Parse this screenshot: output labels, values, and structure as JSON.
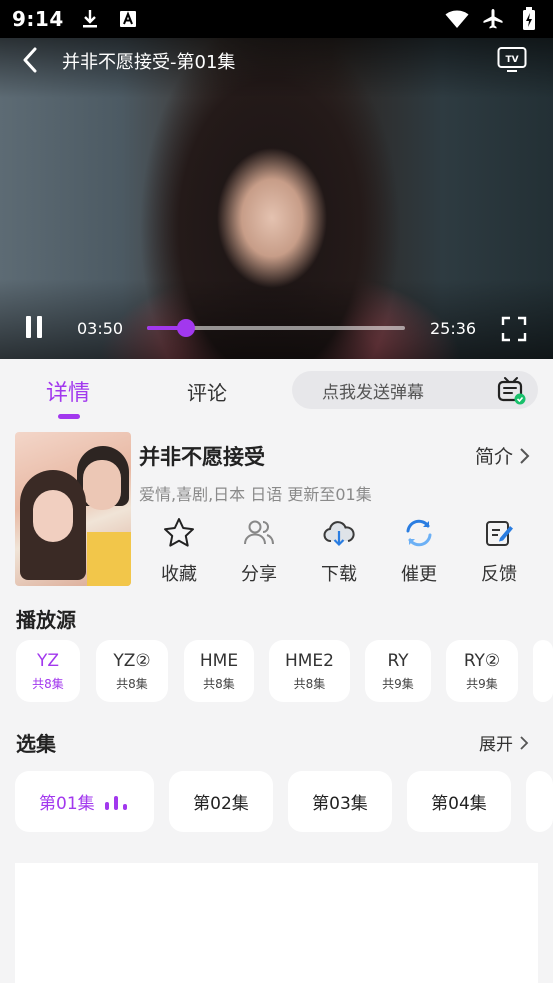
{
  "status_bar": {
    "time": "9:14",
    "left_icons": [
      "download-icon",
      "font-a-icon"
    ],
    "right_icons": [
      "wifi-icon",
      "airplane-icon",
      "battery-charging-icon"
    ]
  },
  "player": {
    "title": "并非不愿接受-第01集",
    "current_time": "03:50",
    "total_time": "25:36",
    "progress_fraction": 0.15,
    "accent_color": "#a238ee"
  },
  "tabs": {
    "details": "详情",
    "comments": "评论",
    "active": "details"
  },
  "danmu": {
    "placeholder": "点我发送弹幕"
  },
  "show": {
    "title": "并非不愿接受",
    "meta": "爱情,喜剧,日本 日语 更新至01集",
    "intro_label": "简介"
  },
  "actions": [
    {
      "label": "收藏",
      "icon": "star-icon"
    },
    {
      "label": "分享",
      "icon": "people-icon"
    },
    {
      "label": "下载",
      "icon": "cloud-download-icon"
    },
    {
      "label": "催更",
      "icon": "refresh-icon"
    },
    {
      "label": "反馈",
      "icon": "edit-icon"
    }
  ],
  "sources": {
    "title": "播放源",
    "items": [
      {
        "name": "YZ",
        "count": "共8集",
        "active": true
      },
      {
        "name": "YZ②",
        "count": "共8集"
      },
      {
        "name": "HME",
        "count": "共8集"
      },
      {
        "name": "HME2",
        "count": "共8集"
      },
      {
        "name": "RY",
        "count": "共9集"
      },
      {
        "name": "RY②",
        "count": "共9集"
      }
    ]
  },
  "episodes": {
    "title": "选集",
    "expand_label": "展开",
    "items": [
      "第01集",
      "第02集",
      "第03集",
      "第04集"
    ],
    "active_index": 0
  }
}
